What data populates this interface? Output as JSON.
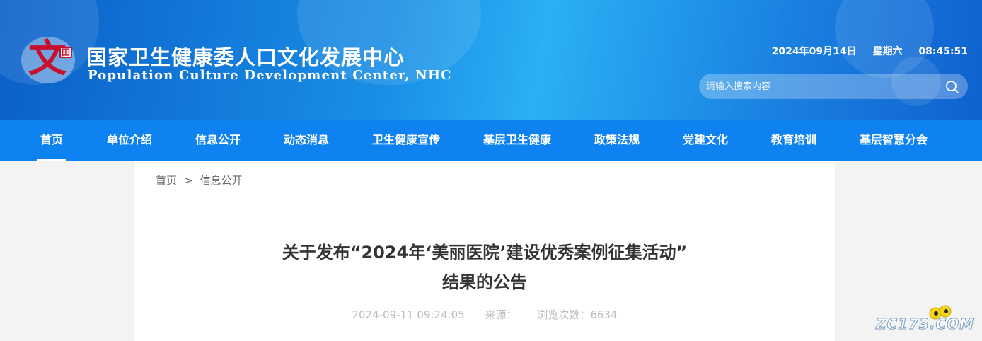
{
  "header": {
    "title": "国家卫生健康委人口文化发展中心",
    "subtitle": "Population Culture Development Center, NHC",
    "logo_char": "文",
    "logo_mark": "田",
    "date": "2024年09月14日",
    "weekday": "星期六",
    "time": "08:45:51",
    "search_placeholder": "请输入搜索内容",
    "search_icon": "search-icon"
  },
  "nav": {
    "items": [
      {
        "label": "首页",
        "active": true
      },
      {
        "label": "单位介绍"
      },
      {
        "label": "信息公开"
      },
      {
        "label": "动态消息"
      },
      {
        "label": "卫生健康宣传"
      },
      {
        "label": "基层卫生健康"
      },
      {
        "label": "政策法规"
      },
      {
        "label": "党建文化"
      },
      {
        "label": "教育培训"
      },
      {
        "label": "基层智慧分会"
      }
    ]
  },
  "breadcrumb": {
    "home": "首页",
    "separator": ">",
    "current": "信息公开"
  },
  "article": {
    "title_line1": "关于发布“2024年‘美丽医院’建设优秀案例征集活动”",
    "title_line2": "结果的公告",
    "date": "2024-09-11 09:24:05",
    "source": "来源：",
    "views": "浏览次数：6634"
  },
  "watermark": {
    "text": "ZC173.COM"
  },
  "colors": {
    "header_blue": "#1a8fe6",
    "nav_blue": "#0d82f0",
    "logo_red": "#c8102e"
  }
}
